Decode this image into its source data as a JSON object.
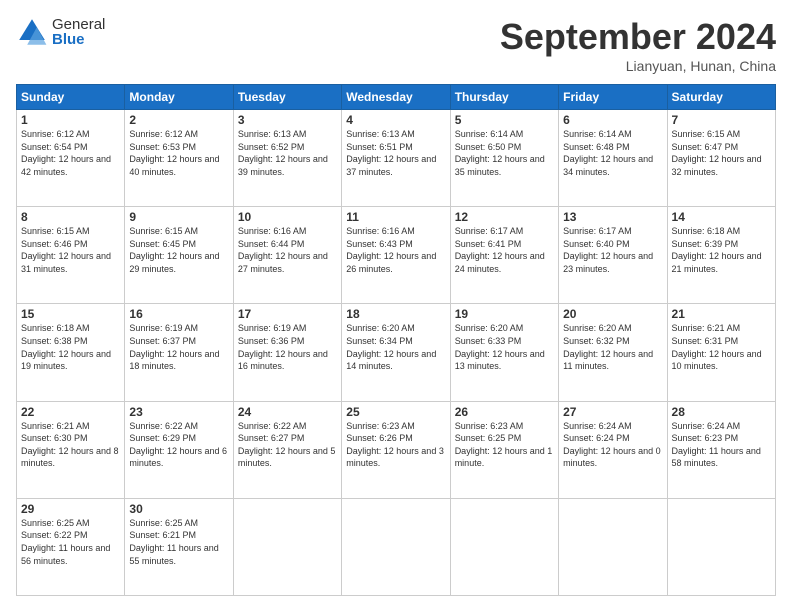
{
  "header": {
    "logo_general": "General",
    "logo_blue": "Blue",
    "month_title": "September 2024",
    "location": "Lianyuan, Hunan, China"
  },
  "days_of_week": [
    "Sunday",
    "Monday",
    "Tuesday",
    "Wednesday",
    "Thursday",
    "Friday",
    "Saturday"
  ],
  "weeks": [
    [
      {
        "day": "1",
        "sunrise": "6:12 AM",
        "sunset": "6:54 PM",
        "daylight": "12 hours and 42 minutes."
      },
      {
        "day": "2",
        "sunrise": "6:12 AM",
        "sunset": "6:53 PM",
        "daylight": "12 hours and 40 minutes."
      },
      {
        "day": "3",
        "sunrise": "6:13 AM",
        "sunset": "6:52 PM",
        "daylight": "12 hours and 39 minutes."
      },
      {
        "day": "4",
        "sunrise": "6:13 AM",
        "sunset": "6:51 PM",
        "daylight": "12 hours and 37 minutes."
      },
      {
        "day": "5",
        "sunrise": "6:14 AM",
        "sunset": "6:50 PM",
        "daylight": "12 hours and 35 minutes."
      },
      {
        "day": "6",
        "sunrise": "6:14 AM",
        "sunset": "6:48 PM",
        "daylight": "12 hours and 34 minutes."
      },
      {
        "day": "7",
        "sunrise": "6:15 AM",
        "sunset": "6:47 PM",
        "daylight": "12 hours and 32 minutes."
      }
    ],
    [
      {
        "day": "8",
        "sunrise": "6:15 AM",
        "sunset": "6:46 PM",
        "daylight": "12 hours and 31 minutes."
      },
      {
        "day": "9",
        "sunrise": "6:15 AM",
        "sunset": "6:45 PM",
        "daylight": "12 hours and 29 minutes."
      },
      {
        "day": "10",
        "sunrise": "6:16 AM",
        "sunset": "6:44 PM",
        "daylight": "12 hours and 27 minutes."
      },
      {
        "day": "11",
        "sunrise": "6:16 AM",
        "sunset": "6:43 PM",
        "daylight": "12 hours and 26 minutes."
      },
      {
        "day": "12",
        "sunrise": "6:17 AM",
        "sunset": "6:41 PM",
        "daylight": "12 hours and 24 minutes."
      },
      {
        "day": "13",
        "sunrise": "6:17 AM",
        "sunset": "6:40 PM",
        "daylight": "12 hours and 23 minutes."
      },
      {
        "day": "14",
        "sunrise": "6:18 AM",
        "sunset": "6:39 PM",
        "daylight": "12 hours and 21 minutes."
      }
    ],
    [
      {
        "day": "15",
        "sunrise": "6:18 AM",
        "sunset": "6:38 PM",
        "daylight": "12 hours and 19 minutes."
      },
      {
        "day": "16",
        "sunrise": "6:19 AM",
        "sunset": "6:37 PM",
        "daylight": "12 hours and 18 minutes."
      },
      {
        "day": "17",
        "sunrise": "6:19 AM",
        "sunset": "6:36 PM",
        "daylight": "12 hours and 16 minutes."
      },
      {
        "day": "18",
        "sunrise": "6:20 AM",
        "sunset": "6:34 PM",
        "daylight": "12 hours and 14 minutes."
      },
      {
        "day": "19",
        "sunrise": "6:20 AM",
        "sunset": "6:33 PM",
        "daylight": "12 hours and 13 minutes."
      },
      {
        "day": "20",
        "sunrise": "6:20 AM",
        "sunset": "6:32 PM",
        "daylight": "12 hours and 11 minutes."
      },
      {
        "day": "21",
        "sunrise": "6:21 AM",
        "sunset": "6:31 PM",
        "daylight": "12 hours and 10 minutes."
      }
    ],
    [
      {
        "day": "22",
        "sunrise": "6:21 AM",
        "sunset": "6:30 PM",
        "daylight": "12 hours and 8 minutes."
      },
      {
        "day": "23",
        "sunrise": "6:22 AM",
        "sunset": "6:29 PM",
        "daylight": "12 hours and 6 minutes."
      },
      {
        "day": "24",
        "sunrise": "6:22 AM",
        "sunset": "6:27 PM",
        "daylight": "12 hours and 5 minutes."
      },
      {
        "day": "25",
        "sunrise": "6:23 AM",
        "sunset": "6:26 PM",
        "daylight": "12 hours and 3 minutes."
      },
      {
        "day": "26",
        "sunrise": "6:23 AM",
        "sunset": "6:25 PM",
        "daylight": "12 hours and 1 minute."
      },
      {
        "day": "27",
        "sunrise": "6:24 AM",
        "sunset": "6:24 PM",
        "daylight": "12 hours and 0 minutes."
      },
      {
        "day": "28",
        "sunrise": "6:24 AM",
        "sunset": "6:23 PM",
        "daylight": "11 hours and 58 minutes."
      }
    ],
    [
      {
        "day": "29",
        "sunrise": "6:25 AM",
        "sunset": "6:22 PM",
        "daylight": "11 hours and 56 minutes."
      },
      {
        "day": "30",
        "sunrise": "6:25 AM",
        "sunset": "6:21 PM",
        "daylight": "11 hours and 55 minutes."
      },
      null,
      null,
      null,
      null,
      null
    ]
  ]
}
